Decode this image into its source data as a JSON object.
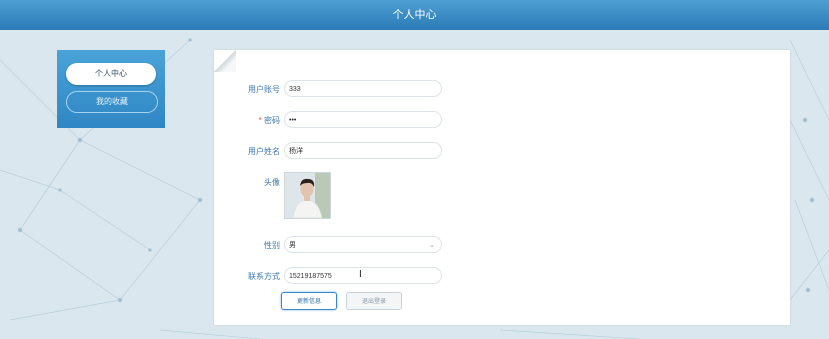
{
  "header": {
    "title": "个人中心"
  },
  "sidebar": {
    "items": [
      {
        "label": "个人中心",
        "active": true
      },
      {
        "label": "我的收藏",
        "active": false
      }
    ]
  },
  "form": {
    "account_label": "用户账号",
    "account_value": "333",
    "password_label": "密码",
    "password_required_mark": "*",
    "password_value": "•••",
    "name_label": "用户姓名",
    "name_value": "杨洋",
    "avatar_label": "头像",
    "gender_label": "性别",
    "gender_value": "男",
    "contact_label": "联系方式",
    "contact_value": "15219187575"
  },
  "buttons": {
    "update_label": "更新信息",
    "logout_label": "退出登录"
  },
  "colors": {
    "header_bg": "#2b7bb7",
    "sidebar_bg": "#3a93cd",
    "label_color": "#3b78b0",
    "required_color": "#e0504b"
  },
  "icons": {
    "select_caret": "chevron-down-icon",
    "text_cursor": "text-cursor-icon"
  }
}
